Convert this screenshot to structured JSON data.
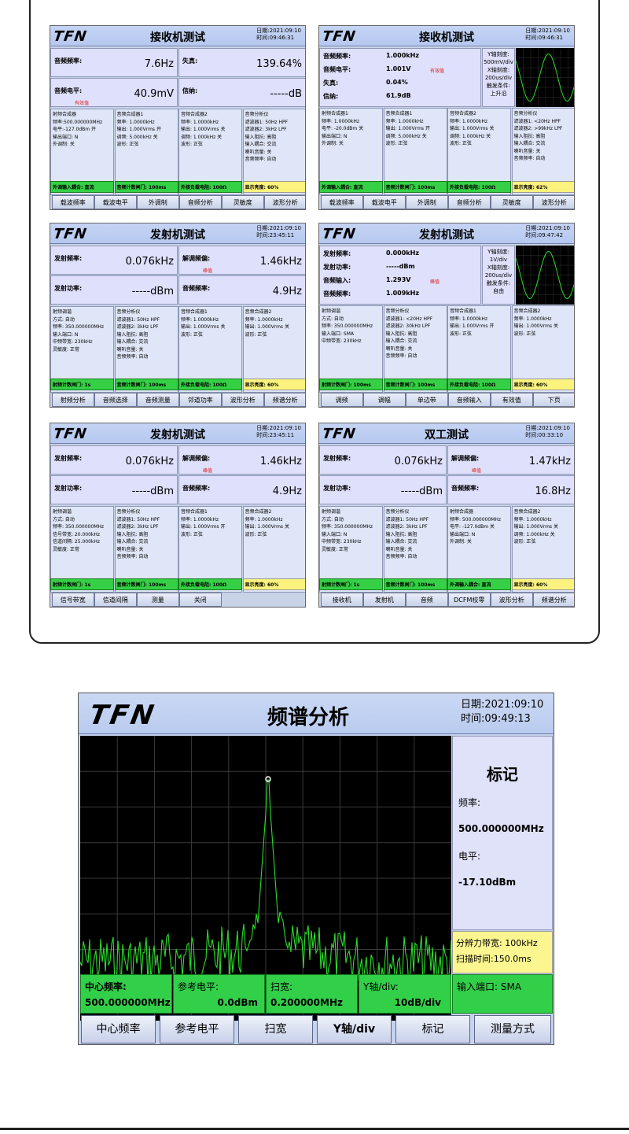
{
  "logo": "TFN",
  "s1": {
    "title": "接收机测试",
    "date": "日期:2021:09:10",
    "time": "时间:09:46:31",
    "lab1": "音频频率:",
    "val1": "7.6Hz",
    "lab2": "失真:",
    "val2": "139.64%",
    "lab3": "音频电平:",
    "note3": "有效值",
    "val3": "40.9mV",
    "lab4": "信纳:",
    "val4": "-----dB",
    "c1": [
      "射频合成器",
      "频率:500.000000MHz",
      "电平:-127.0dBm  开",
      "输出端口: N",
      "外调制: 关"
    ],
    "c2": [
      "音频合成器1",
      "频率: 1.0000kHz",
      "输出: 1.000Vrms  开",
      "调频: 5.000kHz  关",
      "波形: 正弦"
    ],
    "c3": [
      "音频合成器2",
      "频率: 1.0000kHz",
      "输出: 1.000Vrms  关",
      "调频: 1.000kHz  关",
      "波形: 正弦"
    ],
    "c4": [
      "音频分析仪",
      "滤波器1:  50Hz HPF",
      "滤波器2:  3kHz LPF",
      "输入阻抗: 高阻",
      "输入耦合: 交流",
      "喇叭音量: 关",
      "音频频率: 自动"
    ],
    "g1": "外调输入耦合: 直流",
    "g2": "音频计数闸门: 100ms",
    "g3": "外接负载电阻: 100Ω",
    "y1": "显示亮度: 60%",
    "btns": [
      "载波频率",
      "载波电平",
      "外调制",
      "音频分析",
      "灵敏度",
      "波形分析"
    ]
  },
  "s2": {
    "title": "接收机测试",
    "date": "日期:2021:09:10",
    "time": "时间:09:46:31",
    "r1l": "音频频率:",
    "r1v": "1.000kHz",
    "r2l": "音频电平:",
    "r2v": "1.001V",
    "r2n": "有效值",
    "r3l": "失真:",
    "r3v": "0.04%",
    "r4l": "信纳:",
    "r4v": "61.9dB",
    "scope": [
      "Y轴刻度:",
      "500mV/div",
      "X轴刻度:",
      "200us/div",
      "触发条件:",
      "上升沿"
    ],
    "c1": [
      "射频合成器1",
      "频率: 1.0000kHz",
      "电平: -20.0dBm  关",
      "输出端口: N",
      "外调制: 关"
    ],
    "c2": [
      "音频合成器1",
      "频率: 1.0000kHz",
      "输出: 1.000Vrms  开",
      "调频: 5.000kHz  关",
      "波形: 正弦"
    ],
    "c3": [
      "音频合成器2",
      "频率: 1.0000kHz",
      "输出: 1.000Vrms  关",
      "调频: 1.000kHz  关",
      "波形: 正弦"
    ],
    "c4": [
      "音频分析仪",
      "滤波器1:  <20Hz HPF",
      "滤波器2:  >99kHz LPF",
      "输入阻抗: 高阻",
      "输入耦合: 交流",
      "喇叭音量: 关",
      "音频频率: 自动"
    ],
    "g1": "外调输入耦合: 直流",
    "g2": "音频计数闸门: 100ms",
    "g3": "外接负载电阻: 100Ω",
    "y1": "显示亮度: 62%",
    "btns": [
      "载波频率",
      "载波电平",
      "外调制",
      "音频分析",
      "灵敏度",
      "波形分析"
    ]
  },
  "s3": {
    "title": "发射机测试",
    "date": "日期:2021:09:10",
    "time": "时间:23:45:11",
    "lab1": "发射频率:",
    "val1": "0.076kHz",
    "lab2": "解调频偏:",
    "note2": "峰值",
    "val2": "1.46kHz",
    "lab3": "发射功率:",
    "val3": "-----dBm",
    "lab4": "音频频率:",
    "val4": "4.9Hz",
    "c1": [
      "射频调谐",
      "方式: 自动",
      "频率: 350.000000MHz",
      "输入端口: N",
      "中频带宽: 230kHz",
      "灵敏度: 正常"
    ],
    "c2": [
      "音频分析仪",
      "滤波器1:  50Hz HPF",
      "滤波器2:  3kHz LPF",
      "输入阻抗: 高阻",
      "输入耦合: 交流",
      "喇叭音量: 关",
      "音频频率: 自动"
    ],
    "c3": [
      "音频合成器1",
      "频率: 1.0000kHz",
      "输出: 1.000Vrms  关",
      "波形: 正弦"
    ],
    "c4": [
      "音频合成器2",
      "频率: 1.0000kHz",
      "输出: 1.000Vrms  关",
      "波形: 正弦"
    ],
    "g1": "射频计数闸门: 1s",
    "g2": "音频计数闸门: 100ms",
    "g3": "外接负载电阻: 100Ω",
    "y1": "显示亮度: 60%",
    "btns": [
      "射频分析",
      "音频选择",
      "音频测量",
      "邻道功率",
      "波形分析",
      "频谱分析"
    ]
  },
  "s4": {
    "title": "发射机测试",
    "date": "日期:2021:09:10",
    "time": "时间:09:47:42",
    "r1l": "发射频率:",
    "r1v": "0.000kHz",
    "r2l": "发射功率:",
    "r2v": "-----dBm",
    "r3l": "音频输入:",
    "r3v": "1.293V",
    "r3n": "峰值",
    "r4l": "音频频率:",
    "r4v": "1.009kHz",
    "scope": [
      "Y轴刻度:",
      "1V/div",
      "X轴刻度:",
      "200us/div",
      "触发条件:",
      "自由"
    ],
    "c1": [
      "射频调谐",
      "方式: 自动",
      "频率: 350.000000MHz",
      "输入端口: SMA",
      "中频带宽: 230kHz"
    ],
    "c2": [
      "音频分析仪",
      "滤波器1:  <20Hz HPF",
      "滤波器2:  30kHz LPF",
      "输入阻抗: 高阻",
      "输入耦合: 交流",
      "喇叭音量: 关",
      "音频频率: 自动"
    ],
    "c3": [
      "音频合成器1",
      "频率: 1.0000kHz",
      "输出: 1.000Vrms  开",
      "波形: 正弦"
    ],
    "c4": [
      "音频合成器2",
      "频率: 1.0000kHz",
      "输出: 1.000Vrms  关",
      "波形: 正弦"
    ],
    "g1": "射频计数闸门: 100ms",
    "g2": "音频计数闸门: 100ms",
    "g3": "外接负载电阻: 100Ω",
    "y1": "显示亮度: 60%",
    "btns": [
      "调频",
      "调幅",
      "单边带",
      "音频输入",
      "有效值",
      "下页"
    ]
  },
  "s5": {
    "title": "发射机测试",
    "date": "日期:2021:09:10",
    "time": "时间:23:45:11",
    "lab1": "发射频率:",
    "val1": "0.076kHz",
    "lab2": "解调频偏:",
    "note2": "峰值",
    "val2": "1.46kHz",
    "lab3": "发射功率:",
    "val3": "-----dBm",
    "lab4": "音频频率:",
    "val4": "4.9Hz",
    "c1": [
      "射频调谐",
      "方式: 自动",
      "频率: 350.000000MHz",
      "信号带宽: 20.000kHz",
      "信道间隔: 25.000kHz",
      "灵敏度: 正常"
    ],
    "c2": [
      "音频分析仪",
      "滤波器1:  50Hz HPF",
      "滤波器2:  3kHz LPF",
      "输入阻抗: 高阻",
      "输入耦合: 交流",
      "喇叭音量: 关",
      "音频频率: 自动"
    ],
    "c3": [
      "音频合成器1",
      "频率: 1.0000kHz",
      "输出: 1.000Vrms  开",
      "波形: 正弦"
    ],
    "c4": [
      "音频合成器2",
      "频率: 1.0000kHz",
      "输出: 1.000Vrms  关",
      "波形: 正弦"
    ],
    "g1": "射频计数闸门: 1s",
    "g2": "音频计数闸门: 100ms",
    "g3": "外接负载电阻: 100Ω",
    "y1": "显示亮度: 60%",
    "btns": [
      "信号带宽",
      "信道间隔",
      "测量",
      "关闭"
    ]
  },
  "s6": {
    "title": "双工测试",
    "date": "日期:2021:09:10",
    "time": "时间:00:33:10",
    "lab1": "发射频率:",
    "val1": "0.076kHz",
    "lab2": "解调频偏:",
    "note2": "峰值",
    "val2": "1.47kHz",
    "lab3": "发射功率:",
    "val3": "-----dBm",
    "lab4": "音频频率:",
    "val4": "16.8Hz",
    "c1": [
      "射频调谐",
      "方式: 自动",
      "频率: 350.000000MHz",
      "输入端口: N",
      "中频带宽: 230kHz",
      "灵敏度: 正常"
    ],
    "c2": [
      "音频分析仪",
      "滤波器1:  50Hz HPF",
      "滤波器2:  3kHz LPF",
      "输入阻抗: 高阻",
      "输入耦合: 交流",
      "喇叭音量: 关",
      "音频频率: 自动"
    ],
    "c3": [
      "射频合成器",
      "频率: 500.000000MHz",
      "电平: -127.0dBm  关",
      "输出端口: N",
      "外调制: 关"
    ],
    "c4": [
      "音频合成器2",
      "频率: 1.0000kHz",
      "输出: 1.000Vrms  关",
      "调频: 1.000kHz  关",
      "波形: 正弦"
    ],
    "g1": "射频计数闸门: 1s",
    "g2": "音频计数闸门: 100ms",
    "g3": "外调输入耦合: 直流",
    "y1": "显示亮度: 60%",
    "btns": [
      "接收机",
      "发射机",
      "音频",
      "DCFM校零",
      "波形分析",
      "频谱分析"
    ]
  },
  "big": {
    "title": "频谱分析",
    "date": "日期:2021:09:10",
    "time": "时间:09:49:13",
    "marker_title": "标记",
    "freq_label": "频率:",
    "freq_value": "500.000000MHz",
    "level_label": "电平:",
    "level_value": "-17.10dBm",
    "rbw": "分辨力带宽: 100kHz",
    "sweep": "扫描时间:150.0ms",
    "center_label": "中心频率:",
    "center_value": "500.000000MHz",
    "ref_label": "参考电平:",
    "ref_value": "0.0dBm",
    "span_label": "扫宽:",
    "span_value": "0.200000MHz",
    "ydiv_label": "Y轴/div:",
    "ydiv_value": "10dB/div",
    "port": "输入端口: SMA",
    "btns": [
      "中心频率",
      "参考电平",
      "扫宽",
      "Y轴/div",
      "标记",
      "测量方式"
    ]
  },
  "colors": {
    "trace": "#2bdc2b",
    "grid": "#3a3a3a",
    "green": "#35d045",
    "yellow": "#fbf37d"
  }
}
